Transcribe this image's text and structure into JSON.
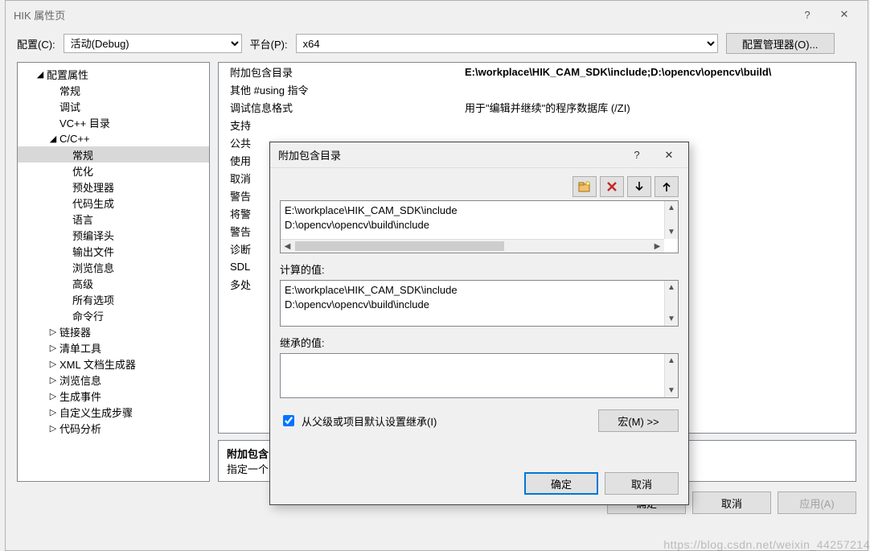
{
  "window": {
    "title": "HIK 属性页",
    "help_label": "?",
    "close_label": "✕"
  },
  "config_row": {
    "config_label": "配置(C):",
    "config_value": "活动(Debug)",
    "platform_label": "平台(P):",
    "platform_value": "x64",
    "manager_label": "配置管理器(O)..."
  },
  "tree": [
    {
      "label": "配置属性",
      "indent": 1,
      "tw": "◢"
    },
    {
      "label": "常规",
      "indent": 2
    },
    {
      "label": "调试",
      "indent": 2
    },
    {
      "label": "VC++ 目录",
      "indent": 2
    },
    {
      "label": "C/C++",
      "indent": 2,
      "tw": "◢"
    },
    {
      "label": "常规",
      "indent": 3,
      "selected": true
    },
    {
      "label": "优化",
      "indent": 3
    },
    {
      "label": "预处理器",
      "indent": 3
    },
    {
      "label": "代码生成",
      "indent": 3
    },
    {
      "label": "语言",
      "indent": 3
    },
    {
      "label": "预编译头",
      "indent": 3
    },
    {
      "label": "输出文件",
      "indent": 3
    },
    {
      "label": "浏览信息",
      "indent": 3
    },
    {
      "label": "高级",
      "indent": 3
    },
    {
      "label": "所有选项",
      "indent": 3
    },
    {
      "label": "命令行",
      "indent": 3
    },
    {
      "label": "链接器",
      "indent": 2,
      "tw": "▷"
    },
    {
      "label": "清单工具",
      "indent": 2,
      "tw": "▷"
    },
    {
      "label": "XML 文档生成器",
      "indent": 2,
      "tw": "▷"
    },
    {
      "label": "浏览信息",
      "indent": 2,
      "tw": "▷"
    },
    {
      "label": "生成事件",
      "indent": 2,
      "tw": "▷"
    },
    {
      "label": "自定义生成步骤",
      "indent": 2,
      "tw": "▷"
    },
    {
      "label": "代码分析",
      "indent": 2,
      "tw": "▷"
    }
  ],
  "grid": {
    "rows": [
      {
        "k": "附加包含目录",
        "v": "E:\\workplace\\HIK_CAM_SDK\\include;D:\\opencv\\opencv\\build\\",
        "selected": true
      },
      {
        "k": "其他 #using 指令",
        "v": ""
      },
      {
        "k": "调试信息格式",
        "v": "用于\"编辑并继续\"的程序数据库 (/ZI)"
      },
      {
        "k": "支持",
        "v": ""
      },
      {
        "k": "公共",
        "v": ""
      },
      {
        "k": "使用",
        "v": ""
      },
      {
        "k": "取消",
        "v": ""
      },
      {
        "k": "警告",
        "v": ""
      },
      {
        "k": "将警",
        "v": ""
      },
      {
        "k": "警告",
        "v": ""
      },
      {
        "k": "诊断",
        "v": ""
      },
      {
        "k": "SDL",
        "v": ""
      },
      {
        "k": "多处",
        "v": ""
      }
    ]
  },
  "desc": {
    "title": "附加包含",
    "body": "指定一个                                                                                                                                                                  径])"
  },
  "dialog": {
    "title": "附加包含目录",
    "help_label": "?",
    "close_label": "✕",
    "paths": [
      "E:\\workplace\\HIK_CAM_SDK\\include",
      "D:\\opencv\\opencv\\build\\include"
    ],
    "calc_label": "计算的值:",
    "calc_values": [
      "E:\\workplace\\HIK_CAM_SDK\\include",
      "D:\\opencv\\opencv\\build\\include"
    ],
    "inherit_label": "继承的值:",
    "inherit_checkbox": "从父级或项目默认设置继承(I)",
    "macro_btn": "宏(M) >>",
    "ok": "确定",
    "cancel": "取消"
  },
  "footer": {
    "ok": "确定",
    "cancel": "取消",
    "apply": "应用(A)"
  },
  "watermark": "https://blog.csdn.net/weixin_44257214"
}
